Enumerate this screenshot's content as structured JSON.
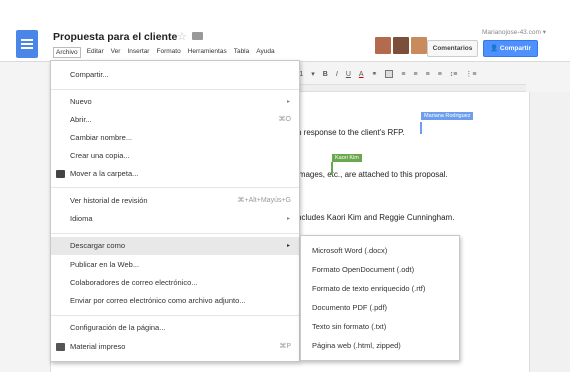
{
  "app": {
    "doc_title": "Propuesta para el cliente",
    "account_email": "Marianojose-43.com ▾",
    "comment_button": "Comentarios",
    "share_button": "Compartir"
  },
  "menubar": [
    "Archivo",
    "Editar",
    "Ver",
    "Insertar",
    "Formato",
    "Herramientas",
    "Tabla",
    "Ayuda"
  ],
  "toolbar": {
    "font_size": "11",
    "bold": "B",
    "italic": "I",
    "underline": "U",
    "text_color": "A"
  },
  "document": {
    "line1": "n response to the client's RFP.",
    "line2": "images, etc., are attached to this proposal.",
    "line3": "ncludes Kaori Kim and Reggie Cunningham.",
    "collaborator1": "Mariana Rodriguez",
    "collaborator2": "Kaori Kim",
    "collaborator1_color": "#6d9eeb",
    "collaborator2_color": "#6aa84f"
  },
  "file_menu": {
    "share": "Compartir...",
    "new": "Nuevo",
    "open": "Abrir...",
    "open_shortcut": "⌘O",
    "rename": "Cambiar nombre...",
    "copy": "Crear una copia...",
    "move": "Mover a la carpeta...",
    "revisions": "Ver historial de revisión",
    "revisions_shortcut": "⌘+Alt+Mayús+G",
    "language": "Idioma",
    "download": "Descargar como",
    "publish": "Publicar en la Web...",
    "email_collab": "Colaboradores de correo electrónico...",
    "email_attach": "Enviar por correo electrónico como archivo adjunto...",
    "page_setup": "Configuración de la página...",
    "print": "Material impreso",
    "print_shortcut": "⌘P"
  },
  "download_submenu": [
    "Microsoft Word (.docx)",
    "Formato OpenDocument (.odt)",
    "Formato de texto enriquecido (.rtf)",
    "Documento PDF (.pdf)",
    "Texto sin formato (.txt)",
    "Página web (.html, zipped)"
  ]
}
